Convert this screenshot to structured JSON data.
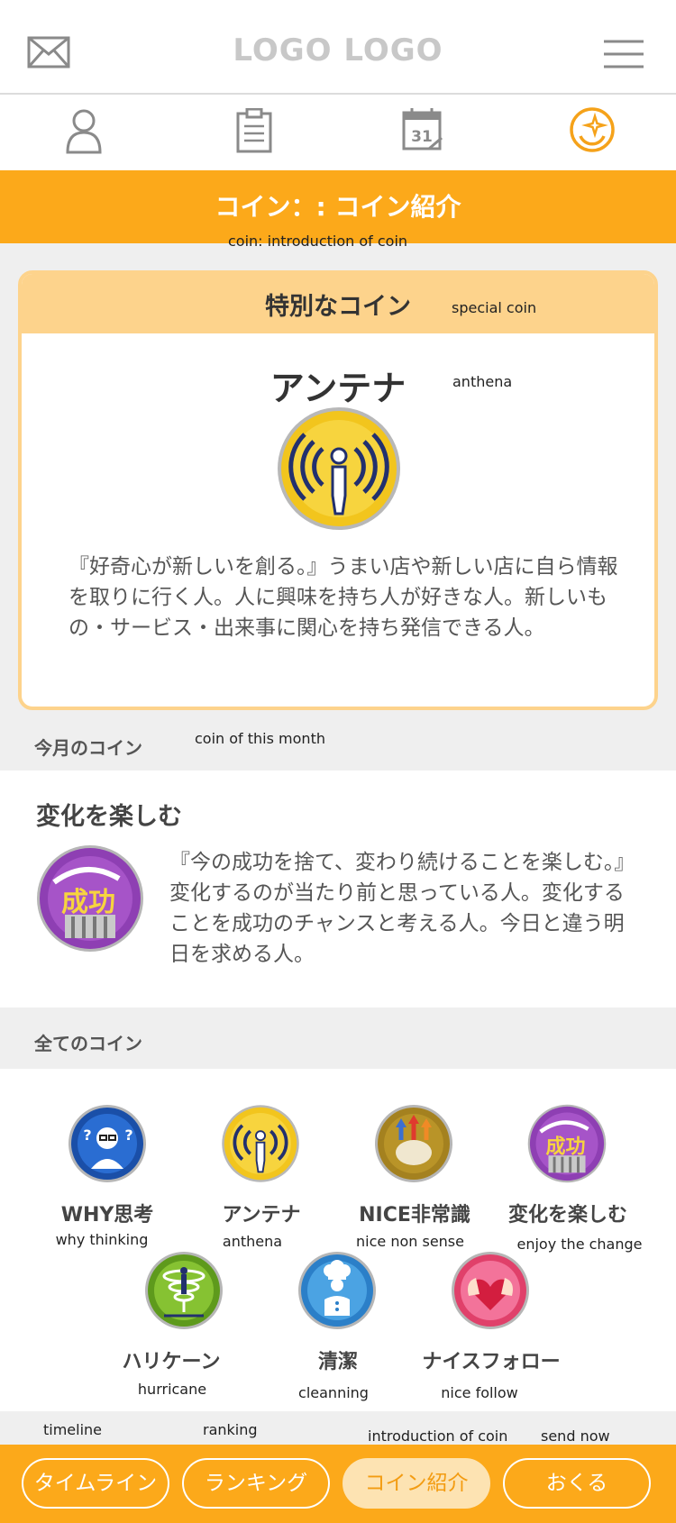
{
  "header": {
    "logo": "LOGO LOGO"
  },
  "icons": [
    "mail-icon",
    "person-icon",
    "clipboard-icon",
    "calendar-icon",
    "coin-icon",
    "hamburger-menu-icon"
  ],
  "calendar_day": "31",
  "title_bar": {
    "title": "コイン：: コイン紹介",
    "note": "coin: introduction of coin"
  },
  "special_card": {
    "header": "特別なコイン",
    "header_note": "special coin",
    "coin_name": "アンテナ",
    "coin_name_note": "anthena",
    "description": "『好奇心が新しいを創る。』うまい店や新しい店に自ら情報を取りに行く人。人に興味を持ち人が好きな人。新しいもの・サービス・出来事に関心を持ち発信できる人。"
  },
  "month_section": {
    "label": "今月のコイン",
    "label_note": "coin of this month",
    "title": "変化を楽しむ",
    "description": "『今の成功を捨て、変わり続けることを楽しむ。』変化するのが当たり前と思っている人。変化することを成功のチャンスと考える人。今日と違う明日を求める人。",
    "badge_text": "成功"
  },
  "all_section": {
    "label": "全てのコイン",
    "coins": [
      {
        "name": "WHY思考",
        "note": "why thinking"
      },
      {
        "name": "アンテナ",
        "note": "anthena"
      },
      {
        "name": "NICE非常識",
        "note": "nice non sense"
      },
      {
        "name": "変化を楽しむ",
        "note": "enjoy the change"
      },
      {
        "name": "ハリケーン",
        "note": "hurricane"
      },
      {
        "name": "清潔",
        "note": "cleanning"
      },
      {
        "name": "ナイスフォロー",
        "note": "nice follow"
      }
    ]
  },
  "bottom_nav": [
    {
      "label": "タイムライン",
      "note": "timeline",
      "active": false
    },
    {
      "label": "ランキング",
      "note": "ranking",
      "active": false
    },
    {
      "label": "コイン紹介",
      "note": "introduction of coin",
      "active": true
    },
    {
      "label": "おくる",
      "note": "send now",
      "active": false
    }
  ],
  "colors": {
    "accent": "#fca91a",
    "card_header": "#fdd38c",
    "background": "#efefef"
  }
}
